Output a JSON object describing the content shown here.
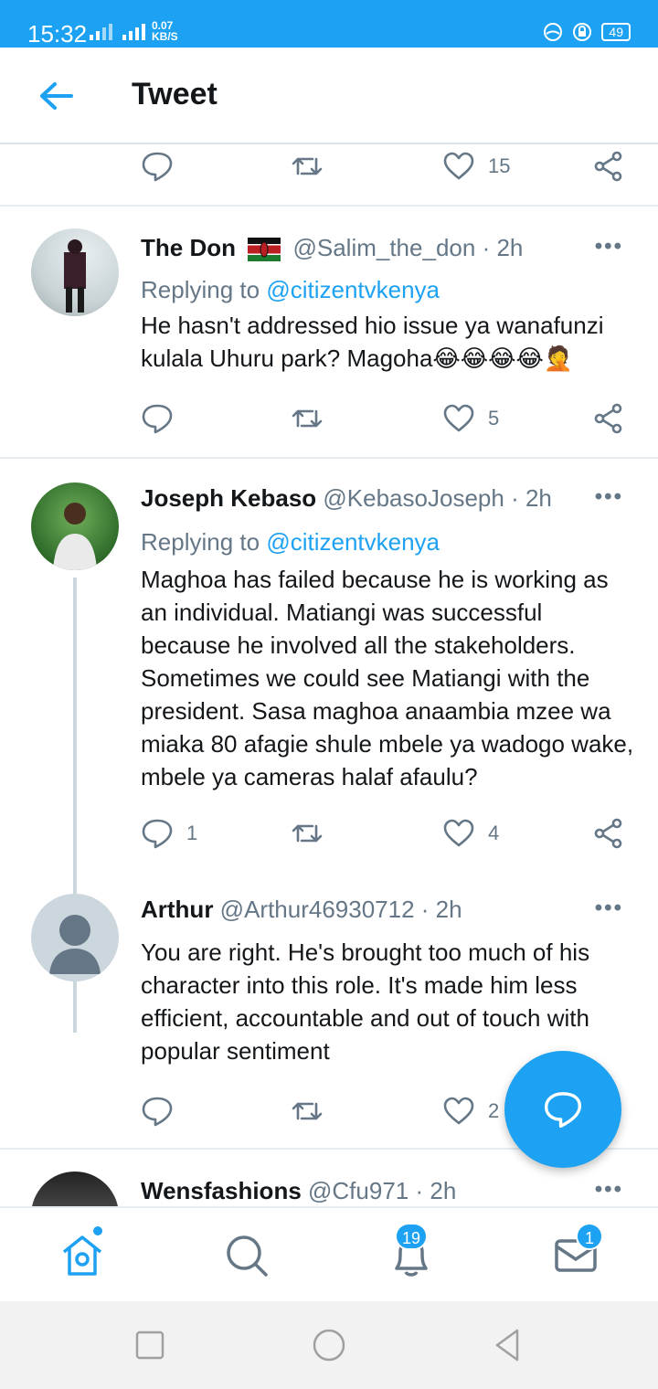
{
  "status_bar": {
    "time": "15:32",
    "net_speed_value": "0.07",
    "net_speed_unit": "KB/S",
    "battery": "49"
  },
  "header": {
    "title": "Tweet"
  },
  "top_actions": {
    "like_count": "15"
  },
  "tweets": [
    {
      "name": "The Don",
      "handle": "@Salim_the_don",
      "time": "· 2h",
      "replying_label": "Replying to",
      "replying_to": "@citizentvkenya",
      "text": "He hasn't addressed hio issue ya wanafunzi kulala Uhuru park? Magoha😂😂😂😂🤦",
      "reply_count": "",
      "like_count": "5"
    },
    {
      "name": "Joseph Kebaso",
      "handle": "@KebasoJoseph",
      "time": "· 2h",
      "replying_label": "Replying to",
      "replying_to": "@citizentvkenya",
      "text": "Maghoa has failed because he is working as an individual. Matiangi was successful because he involved all the stakeholders. Sometimes we could see Matiangi with the president. Sasa maghoa anaambia mzee wa miaka 80 afagie shule mbele ya wadogo wake, mbele ya cameras halaf afaulu?",
      "reply_count": "1",
      "like_count": "4"
    },
    {
      "name": "Arthur",
      "handle": "@Arthur46930712",
      "time": "· 2h",
      "text": "You are right. He's brought too much of his character into this role. It's made him less efficient, accountable and out of touch with popular sentiment",
      "like_count": "2"
    },
    {
      "name": "Wensfashions",
      "handle": "@Cfu971",
      "time": "· 2h"
    }
  ],
  "more_glyph": "•••",
  "bottom_nav": {
    "notifications_badge": "19",
    "messages_badge": "1"
  },
  "colors": {
    "accent": "#1da1f2",
    "text": "#14171a",
    "secondary": "#657786"
  }
}
